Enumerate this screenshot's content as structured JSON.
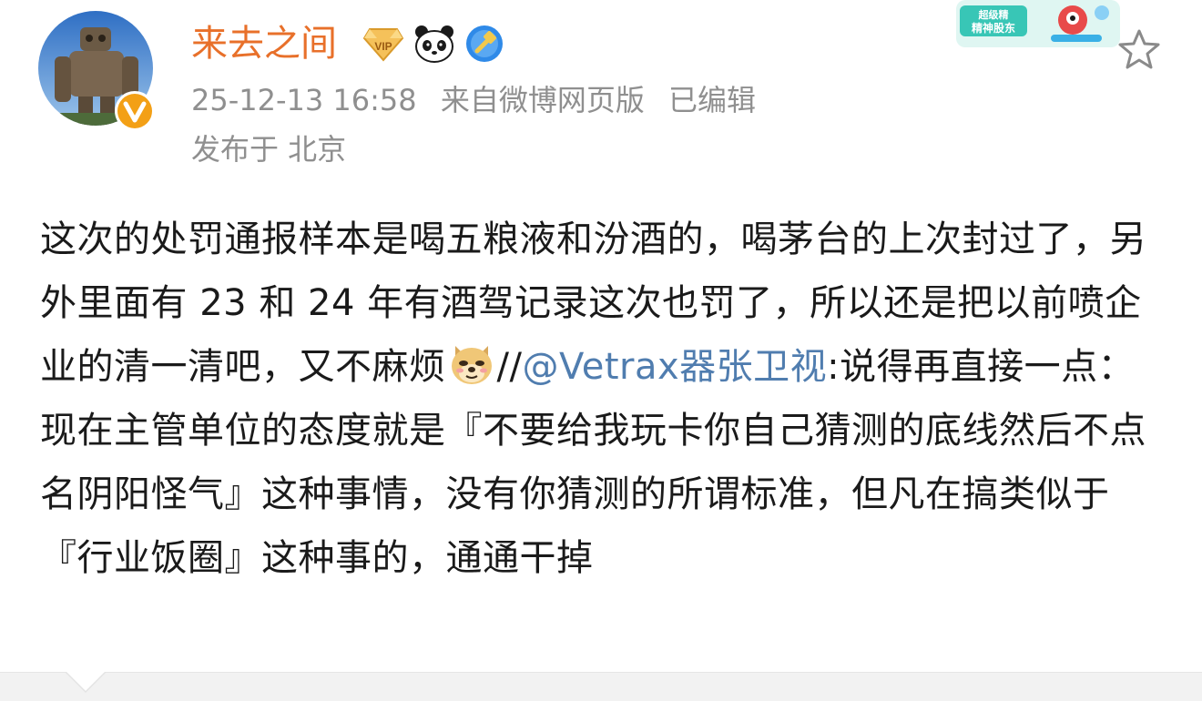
{
  "user": {
    "name": "来去之间"
  },
  "post_meta": {
    "time": "25-12-13 16:58",
    "source": "来自微博网页版",
    "edited": "已编辑",
    "location": "发布于 北京"
  },
  "badges": [
    "vip-diamond-icon",
    "panda-icon",
    "verified-shield-icon"
  ],
  "promo": {
    "text_line1": "超级精",
    "text_line2": "精神股东"
  },
  "content": {
    "part1": "这次的处罚通报样本是喝五粮液和汾酒的，喝茅台的上次封过了，另外里面有 23 和 24 年有酒驾记录这次也罚了，所以还是把以前喷企业的清一清吧，又不麻烦",
    "separator": "//",
    "mention": "@Vetrax器张卫视",
    "part2": ":说得再直接一点：现在主管单位的态度就是『不要给我玩卡你自己猜测的底线然后不点名阴阳怪气』这种事情，没有你猜测的所谓标准，但凡在搞类似于『行业饭圈』这种事的，通通干掉"
  },
  "colors": {
    "username": "#e8702a",
    "meta": "#8f8f8f",
    "mention": "#507daf",
    "text": "#1a1a1a"
  }
}
